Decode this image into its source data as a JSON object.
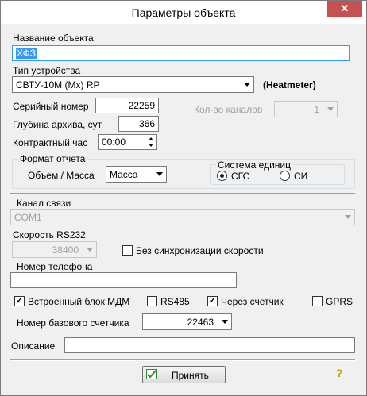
{
  "window": {
    "title": "Параметры объекта",
    "close_glyph": "✕"
  },
  "object_name": {
    "label": "Название объекта",
    "value": "ХФЗ"
  },
  "device_type": {
    "label": "Тип устройства",
    "value": "СВТУ-10М (Мх) RP",
    "tag": "(Heatmeter)"
  },
  "serial": {
    "label": "Серийный номер",
    "value": "22259"
  },
  "channels": {
    "label": "Кол-во каналов",
    "value": "1"
  },
  "archive_depth": {
    "label": "Глубина архива, сут.",
    "value": "366"
  },
  "contract_hour": {
    "label": "Контрактный час",
    "value": "00:00"
  },
  "report_format": {
    "group_label": "Формат отчета",
    "mode_label": "Объем / Масса",
    "mode_value": "Масса",
    "units_group_label": "Система единиц",
    "units": [
      {
        "label": "СГС",
        "selected": true
      },
      {
        "label": "СИ",
        "selected": false
      }
    ]
  },
  "channel": {
    "label": "Канал связи",
    "value": "COM1"
  },
  "rs232": {
    "label": "Скорость RS232",
    "value": "38400",
    "nosync_label": "Без синхронизации скорости",
    "nosync_checked": false
  },
  "phone": {
    "label": "Номер телефона",
    "value": ""
  },
  "options": {
    "modem": {
      "label": "Встроенный блок МДМ",
      "checked": true
    },
    "rs485": {
      "label": "RS485",
      "checked": false
    },
    "via_meter": {
      "label": "Через счетчик",
      "checked": true
    },
    "gprs": {
      "label": "GPRS",
      "checked": false
    }
  },
  "base_meter": {
    "label": "Номер базового счетчика",
    "value": "22463"
  },
  "description": {
    "label": "Описание",
    "value": ""
  },
  "footer": {
    "accept_label": "Принять",
    "help_glyph": "?"
  },
  "colors": {
    "selection": "#3399ff",
    "close_button": "#c75050",
    "window_bg": "#f0f0f0",
    "help_icon": "#c8a000"
  }
}
